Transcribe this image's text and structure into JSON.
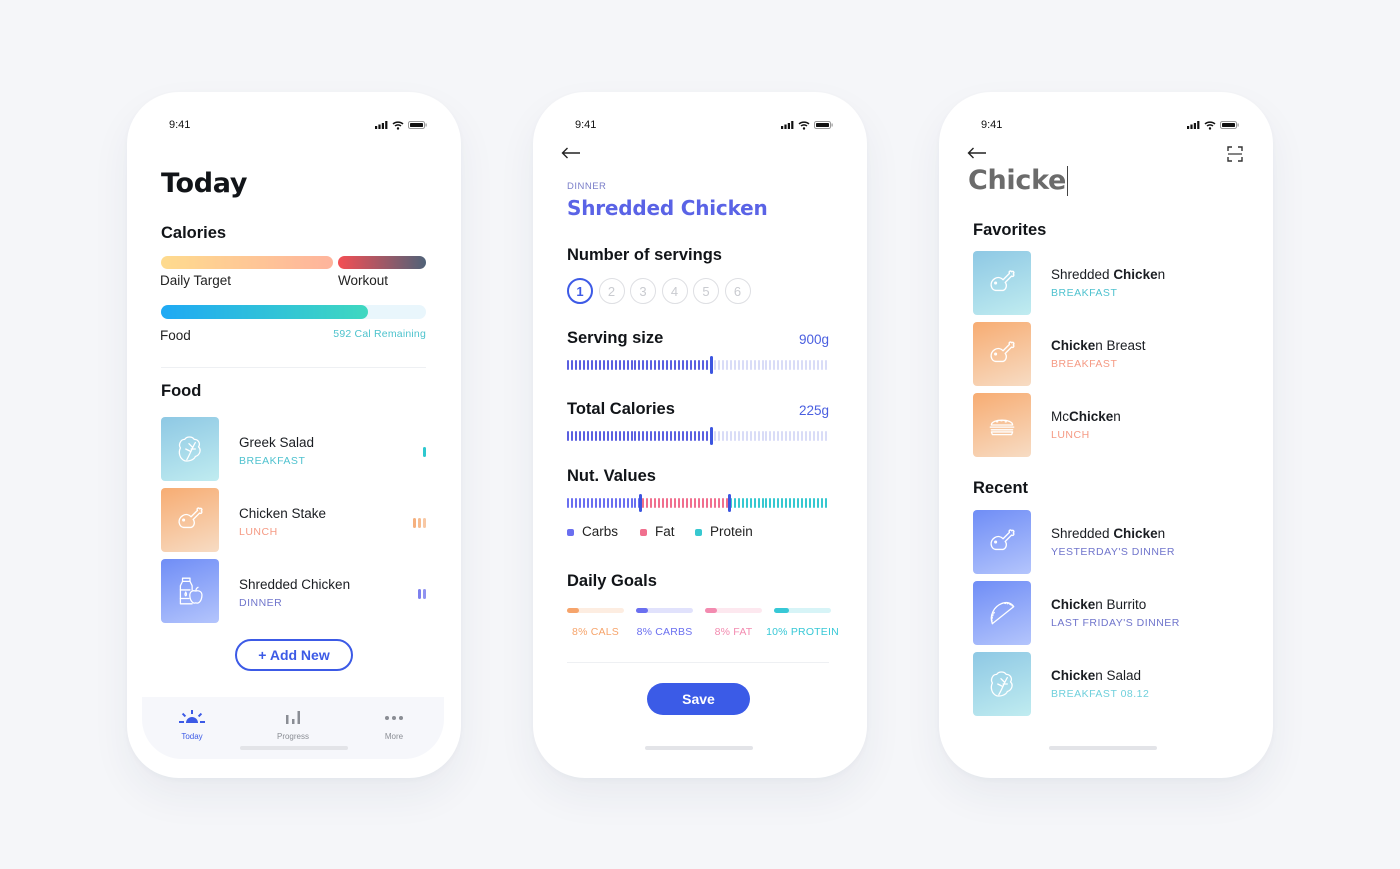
{
  "status_bar": {
    "time": "9:41"
  },
  "screen_today": {
    "title": "Today",
    "calories": {
      "heading": "Calories",
      "daily_target_label": "Daily Target",
      "workout_label": "Workout",
      "food_label": "Food",
      "remaining_text": "592 Cal Remaining",
      "food_progress": 0.78
    },
    "food": {
      "heading": "Food",
      "items": [
        {
          "name": "Greek Salad",
          "meal": "BREAKFAST",
          "meal_color": "#4fc2cf",
          "icon": "lettuce-icon",
          "bars": 1,
          "bar_color": "#2ec8cf"
        },
        {
          "name": "Chicken Stake",
          "meal": "LUNCH",
          "meal_color": "#f59a84",
          "icon": "chicken-leg-icon",
          "bars": 3,
          "bar_color": "#f5b07e"
        },
        {
          "name": "Shredded Chicken",
          "meal": "DINNER",
          "meal_color": "#7075cc",
          "icon": "bottle-apple-icon",
          "bars": 2,
          "bar_color": "#7d80ee"
        }
      ]
    },
    "add_new_label": "+ Add New",
    "tabbar": [
      {
        "label": "Today",
        "icon": "sun-icon",
        "active": true
      },
      {
        "label": "Progress",
        "icon": "bar-chart-icon",
        "active": false
      },
      {
        "label": "More",
        "icon": "more-dots-icon",
        "active": false
      }
    ]
  },
  "screen_detail": {
    "meal_label": "DINNER",
    "title": "Shredded Chicken",
    "servings": {
      "heading": "Number of servings",
      "options": [
        "1",
        "2",
        "3",
        "4",
        "5",
        "6"
      ],
      "selected": "1"
    },
    "serving_size": {
      "heading": "Serving size",
      "value": "900g",
      "fraction": 0.55
    },
    "total_calories": {
      "heading": "Total Calories",
      "value": "225g",
      "fraction": 0.55
    },
    "nut_values": {
      "heading": "Nut. Values",
      "split": [
        0.28,
        0.62
      ],
      "legend": [
        {
          "label": "Carbs",
          "color": "#6a6ff0"
        },
        {
          "label": "Fat",
          "color": "#f06f8e"
        },
        {
          "label": "Protein",
          "color": "#37c8d0"
        }
      ]
    },
    "daily_goals": {
      "heading": "Daily Goals",
      "goals": [
        {
          "label": "8% CALS",
          "percent": 8,
          "color": "#f6a46b"
        },
        {
          "label": "8% CARBS",
          "percent": 8,
          "color": "#6a6ff0"
        },
        {
          "label": "8% FAT",
          "percent": 8,
          "color": "#f38bb0"
        },
        {
          "label": "10% PROTEIN",
          "percent": 10,
          "color": "#37c8d6"
        }
      ]
    },
    "save_label": "Save"
  },
  "screen_search": {
    "query": "Chicke",
    "favorites": {
      "heading": "Favorites",
      "items": [
        {
          "pre": "Shredded ",
          "match": "Chicke",
          "post": "n",
          "meal": "BREAKFAST",
          "meal_color": "#4fc2cf",
          "icon": "chicken-leg-icon"
        },
        {
          "pre": "",
          "match": "Chicke",
          "post": "n Breast",
          "meal": "BREAKFAST",
          "meal_color": "#f59a84",
          "icon": "chicken-leg-icon"
        },
        {
          "pre": "Mc",
          "match": "Chicke",
          "post": "n",
          "meal": "LUNCH",
          "meal_color": "#f59a84",
          "icon": "burger-icon"
        }
      ]
    },
    "recent": {
      "heading": "Recent",
      "items": [
        {
          "pre": "Shredded ",
          "match": "Chicke",
          "post": "n",
          "meal": "YESTERDAY'S DINNER",
          "meal_color": "#7075cc",
          "icon": "chicken-leg-icon"
        },
        {
          "pre": "",
          "match": "Chicke",
          "post": "n Burrito",
          "meal": "LAST FRIDAY'S DINNER",
          "meal_color": "#7075cc",
          "icon": "taco-icon"
        },
        {
          "pre": "",
          "match": "Chicke",
          "post": "n Salad",
          "meal": "BREAKFAST 08.12",
          "meal_color": "#6fd0dc",
          "icon": "lettuce-icon"
        }
      ]
    }
  }
}
